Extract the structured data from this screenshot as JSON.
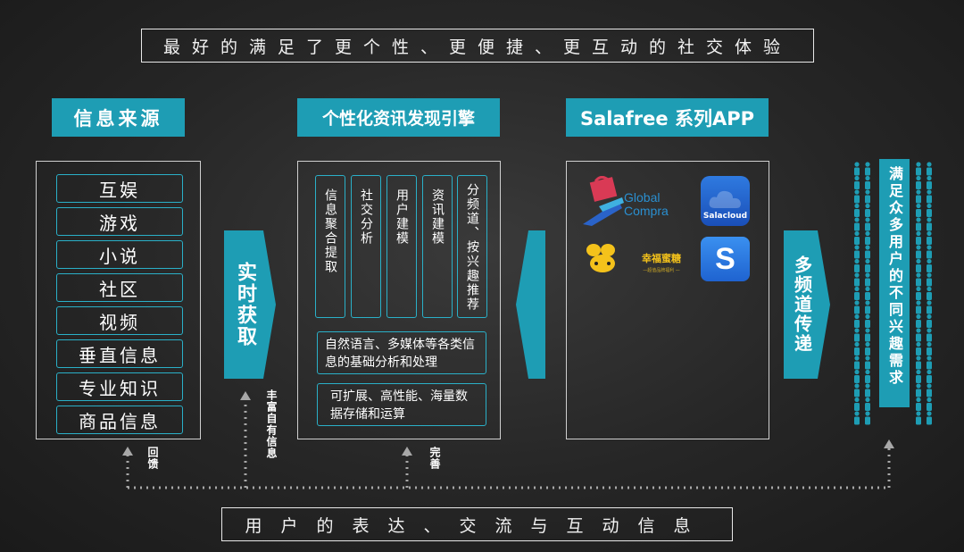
{
  "top_banner": "最好的满足了更个性、更便捷、更互动的社交体验",
  "bottom_banner": "用户的表达、交流与互动信息",
  "source": {
    "header": "信息来源",
    "items": [
      "互娱",
      "游戏",
      "小说",
      "社区",
      "视频",
      "垂直信息",
      "专业知识",
      "商品信息"
    ]
  },
  "arrow_realtime": "实时获取",
  "engine": {
    "header": "个性化资讯发现引擎",
    "columns": [
      "信息聚合提取",
      "社交分析",
      "用户建模",
      "资讯建模",
      "分频道、按兴趣推荐"
    ],
    "box1": "自然语言、多媒体等各类信息的基础分析和处理",
    "box2": "可扩展、高性能、海量数据存储和运算"
  },
  "apps": {
    "header": "Salafree 系列APP",
    "global_compra_line1": "Global",
    "global_compra_line2": "Compra",
    "salacloud": "Salacloud",
    "bee_title": "幸福蜜糖",
    "bee_sub": "—超值品牌福利 —",
    "s_letter": "S"
  },
  "arrow_multichannel": "多频道传递",
  "users_text": "满足众多用户的不同兴趣需求",
  "feedback_labels": {
    "feedback": "回馈",
    "enrich": "丰富自有信息",
    "improve": "完善"
  },
  "colors": {
    "accent": "#1e9db4",
    "line": "#2ab0c8"
  }
}
